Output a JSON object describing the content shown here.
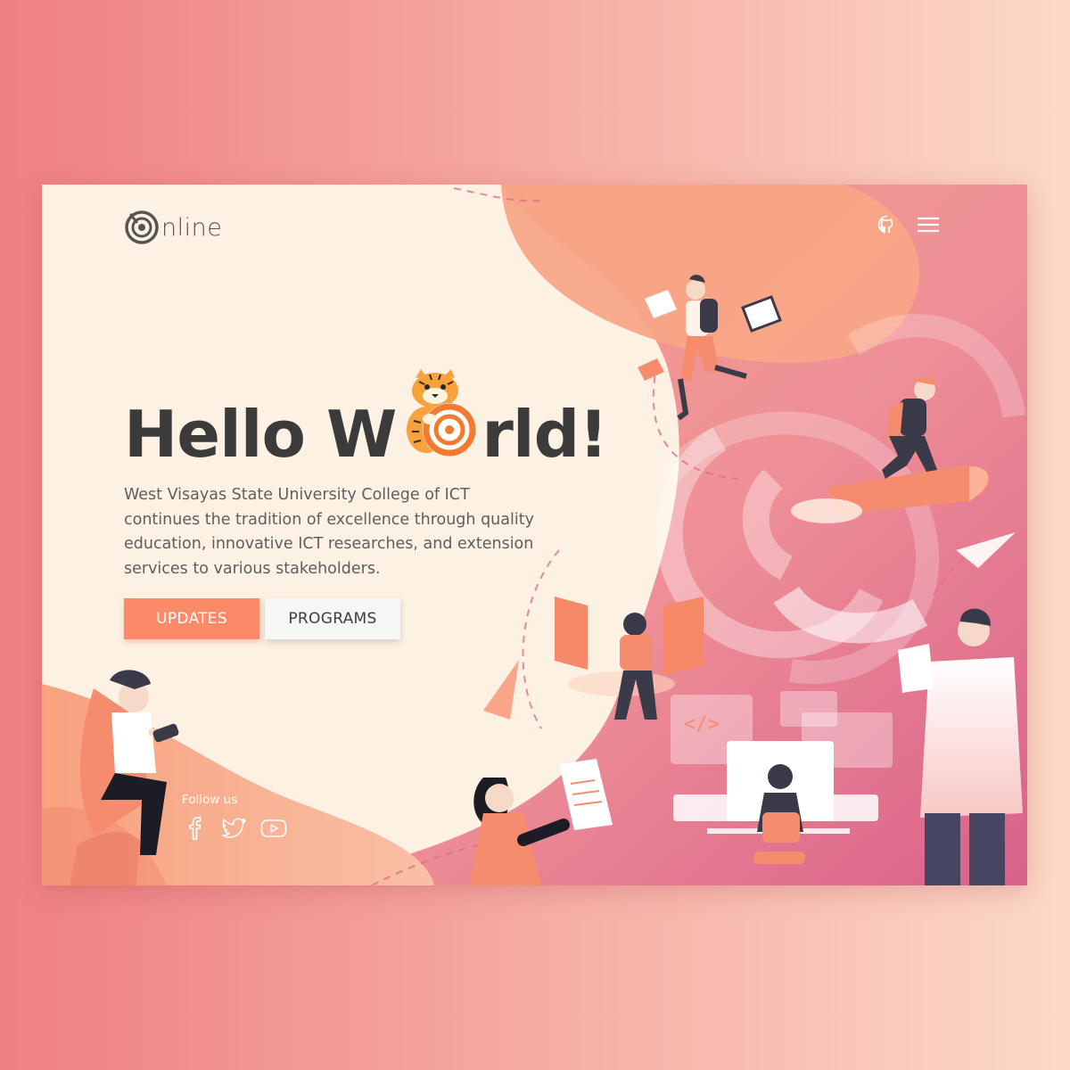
{
  "header": {
    "logo_text": "nline",
    "github_icon": "github-icon",
    "menu_icon": "hamburger-menu-icon"
  },
  "hero": {
    "title_part1": "Hello W",
    "title_part2": "rld!",
    "mascot": "tiger-mascot-logo",
    "description": "West Visayas State University College of ICT continues the tradition of excellence through quality education, innovative ICT researches, and extension services to various stakeholders."
  },
  "buttons": {
    "updates": "UPDATES",
    "programs": "PROGRAMS"
  },
  "social": {
    "label": "Follow us",
    "icons": [
      "facebook-icon",
      "twitter-icon",
      "youtube-icon"
    ]
  },
  "colors": {
    "accent": "#fb8b68",
    "cream": "#fdf1e4",
    "text_dark": "#3b3b3b",
    "pink": "#d95a82"
  }
}
